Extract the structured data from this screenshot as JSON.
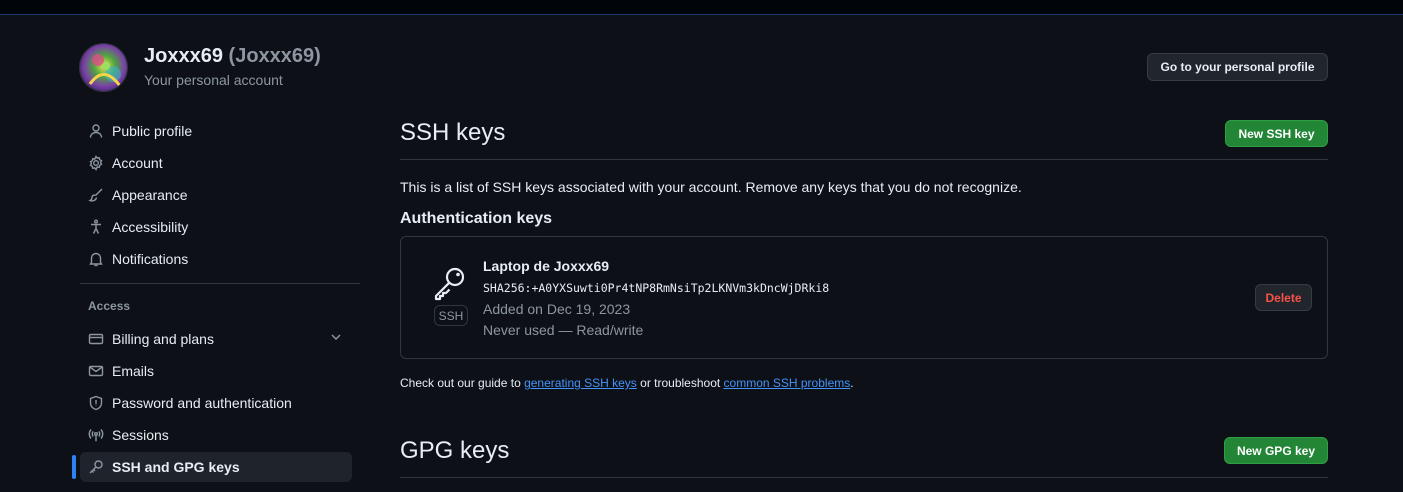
{
  "user": {
    "name": "Joxxx69",
    "login": "(Joxxx69)",
    "subtitle": "Your personal account"
  },
  "header": {
    "profile_button": "Go to your personal profile"
  },
  "sidebar": {
    "items": [
      {
        "label": "Public profile",
        "icon": "person-icon"
      },
      {
        "label": "Account",
        "icon": "gear-icon"
      },
      {
        "label": "Appearance",
        "icon": "paintbrush-icon"
      },
      {
        "label": "Accessibility",
        "icon": "accessibility-icon"
      },
      {
        "label": "Notifications",
        "icon": "bell-icon"
      }
    ],
    "section_access": "Access",
    "access_items": [
      {
        "label": "Billing and plans",
        "icon": "credit-card-icon"
      },
      {
        "label": "Emails",
        "icon": "mail-icon"
      },
      {
        "label": "Password and authentication",
        "icon": "shield-icon"
      },
      {
        "label": "Sessions",
        "icon": "broadcast-icon"
      },
      {
        "label": "SSH and GPG keys",
        "icon": "key-icon",
        "active": true
      }
    ]
  },
  "ssh": {
    "title": "SSH keys",
    "new_button": "New SSH key",
    "description": "This is a list of SSH keys associated with your account. Remove any keys that you do not recognize.",
    "auth_heading": "Authentication keys",
    "key": {
      "title": "Laptop de Joxxx69",
      "fingerprint": "SHA256:+A0YXSuwti0Pr4tNP8RmNsiTp2LKNVm3kDncWjDRki8",
      "added": "Added on Dec 19, 2023",
      "usage": "Never used — Read/write",
      "badge": "SSH",
      "delete_button": "Delete"
    },
    "guide": {
      "prefix": "Check out our guide to ",
      "link1": "generating SSH keys",
      "middle": " or troubleshoot ",
      "link2": "common SSH problems",
      "suffix": "."
    }
  },
  "gpg": {
    "title": "GPG keys",
    "new_button": "New GPG key"
  },
  "colors": {
    "background": "#0d1117",
    "accent": "#2f81f7",
    "primary_button": "#238636",
    "danger": "#f85149",
    "link": "#4493f8"
  }
}
